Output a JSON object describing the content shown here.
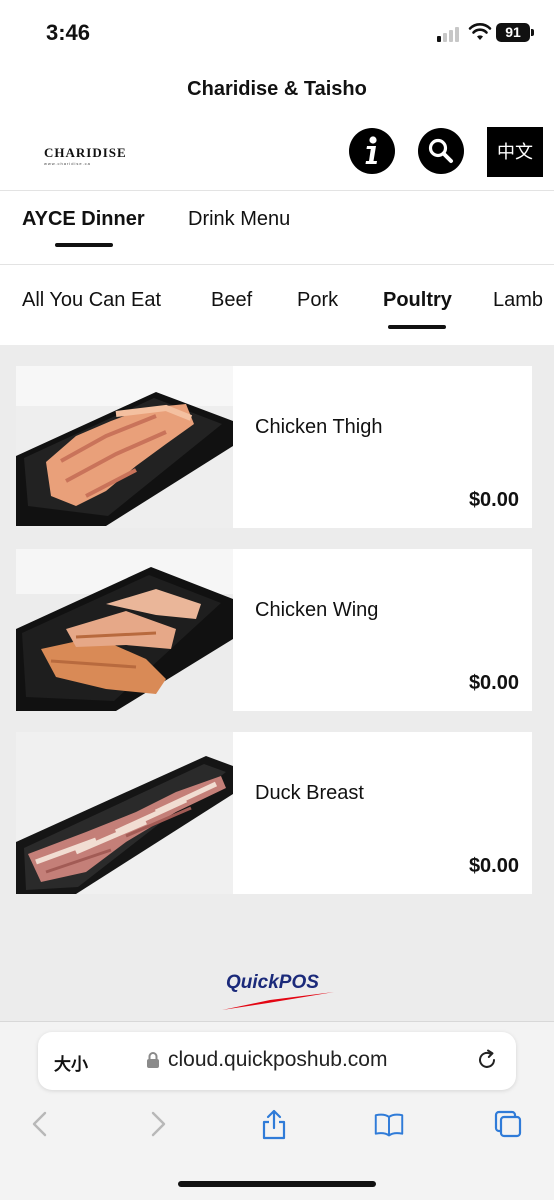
{
  "status_bar": {
    "time": "3:46",
    "battery": "91"
  },
  "header": {
    "title": "Charidise & Taisho",
    "logo_text": "CHARIDISE",
    "logo_subtext": "www.charidise.ca",
    "lang_button": "中文"
  },
  "menu_tabs": [
    {
      "label": "AYCE Dinner",
      "active": true
    },
    {
      "label": "Drink Menu",
      "active": false
    }
  ],
  "categories": [
    {
      "label": "All You Can Eat",
      "active": false
    },
    {
      "label": "Beef",
      "active": false
    },
    {
      "label": "Pork",
      "active": false
    },
    {
      "label": "Poultry",
      "active": true
    },
    {
      "label": "Lamb",
      "active": false
    }
  ],
  "items": [
    {
      "name": "Chicken Thigh",
      "price": "$0.00"
    },
    {
      "name": "Chicken Wing",
      "price": "$0.00"
    },
    {
      "name": "Duck Breast",
      "price": "$0.00"
    }
  ],
  "footer": {
    "brand": "QuickPOS"
  },
  "browser": {
    "text_size": "大小",
    "url": "cloud.quickposhub.com"
  },
  "colors": {
    "accent": "#000000",
    "brand_red": "#e30613",
    "brand_navy": "#1b2a7a",
    "link_blue": "#2f7bd8"
  }
}
